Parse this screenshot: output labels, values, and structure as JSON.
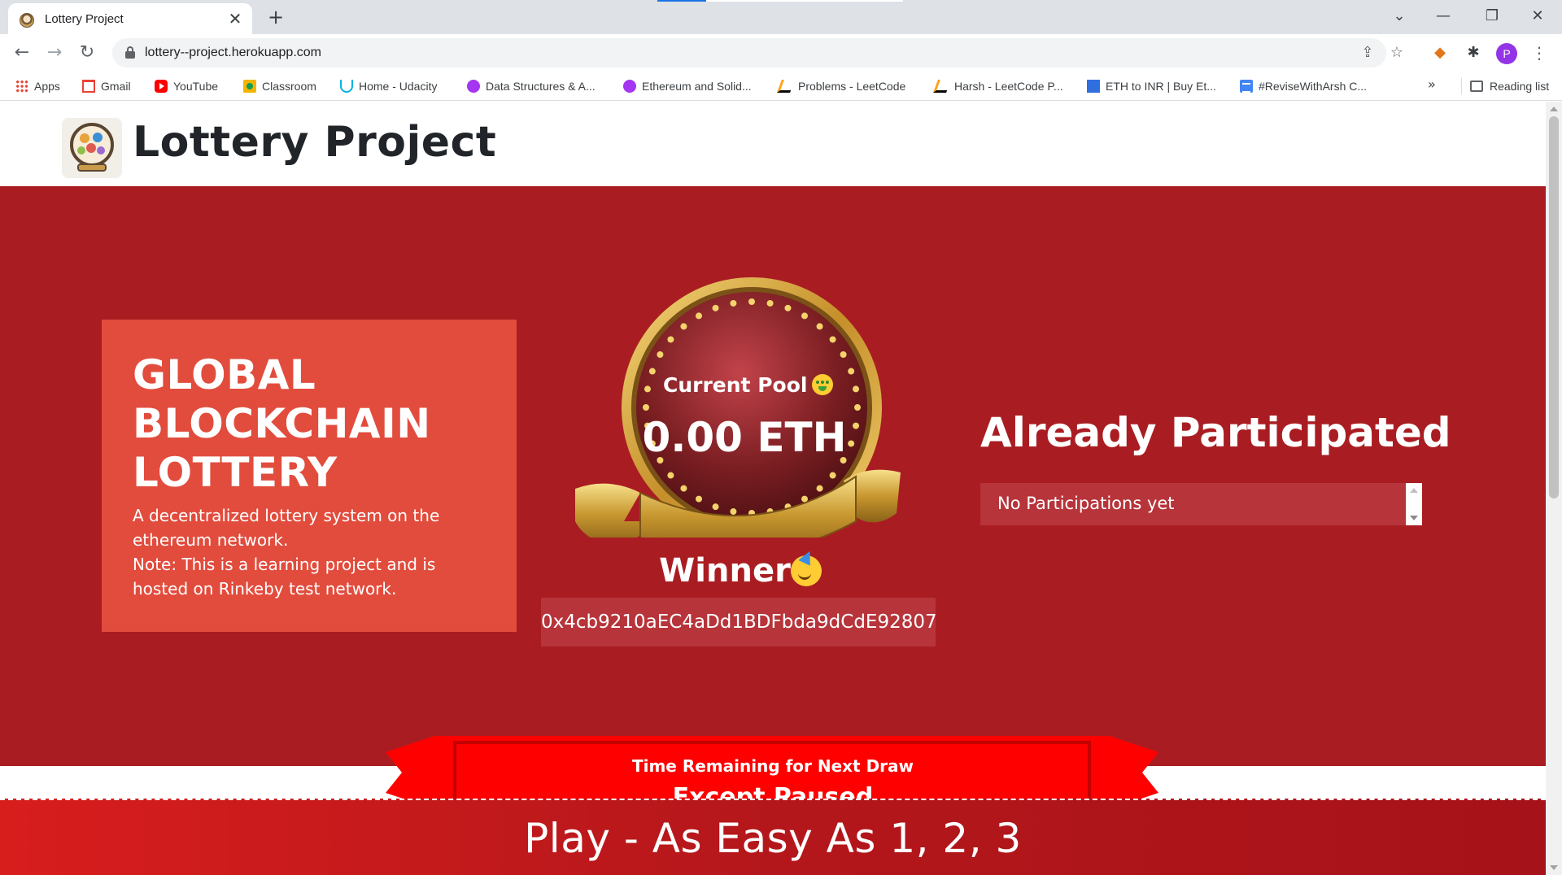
{
  "browser": {
    "tab_title": "Lottery Project",
    "tab_close": "✕",
    "new_tab": "+",
    "url": "lottery--project.herokuapp.com",
    "window_controls": {
      "minimize": "—",
      "maximize": "❐",
      "close": "✕",
      "tab_search": "⌄"
    },
    "nav": {
      "back": "←",
      "forward": "→",
      "reload": "↻"
    },
    "omnibox_icons": {
      "share": "⇪",
      "bookmark_star": "☆"
    },
    "extensions": {
      "metamask": "◆",
      "extensions": "✱"
    },
    "profile_initial": "P",
    "menu": "⋮",
    "bookmarks": [
      {
        "label": "Apps",
        "icon": "apps-icon"
      },
      {
        "label": "Gmail",
        "icon": "gmail-icon"
      },
      {
        "label": "YouTube",
        "icon": "youtube-icon"
      },
      {
        "label": "Classroom",
        "icon": "classroom-icon"
      },
      {
        "label": "Home - Udacity",
        "icon": "udacity-icon"
      },
      {
        "label": "Data Structures & A...",
        "icon": "udemy-icon"
      },
      {
        "label": "Ethereum and Solid...",
        "icon": "udemy-icon"
      },
      {
        "label": "Problems - LeetCode",
        "icon": "leetcode-icon"
      },
      {
        "label": "Harsh - LeetCode P...",
        "icon": "leetcode-icon"
      },
      {
        "label": "ETH to INR | Buy Et...",
        "icon": "eth-exchange-icon"
      },
      {
        "label": "#ReviseWithArsh C...",
        "icon": "google-docs-icon"
      }
    ],
    "bookmarks_overflow": "»",
    "reading_list": "Reading list"
  },
  "site": {
    "title": "Lottery Project",
    "intro": {
      "heading": "GLOBAL BLOCKCHAIN LOTTERY",
      "description": "A decentralized lottery system on the ethereum network.",
      "note": "Note: This is a learning project and is hosted on Rinkeby test network."
    },
    "pool": {
      "label": "Current Pool",
      "value": "0.00 ETH"
    },
    "winner": {
      "label": "Winner",
      "address": "0x4cb9210aEC4aDd1BDFbda9dCdE92807"
    },
    "participated": {
      "title": "Already Participated",
      "empty_text": "No Participations yet"
    },
    "timer": {
      "label": "Time Remaining for Next Draw",
      "value": "Except Paused"
    },
    "play_banner": "Play - As Easy As 1, 2, 3"
  },
  "colors": {
    "hero_background": "#a91d22",
    "intro_card": "#e24c3d",
    "address_box": "#b7343a",
    "timer_ribbon": "#ff0000",
    "medal_gold": "#d4a437"
  }
}
